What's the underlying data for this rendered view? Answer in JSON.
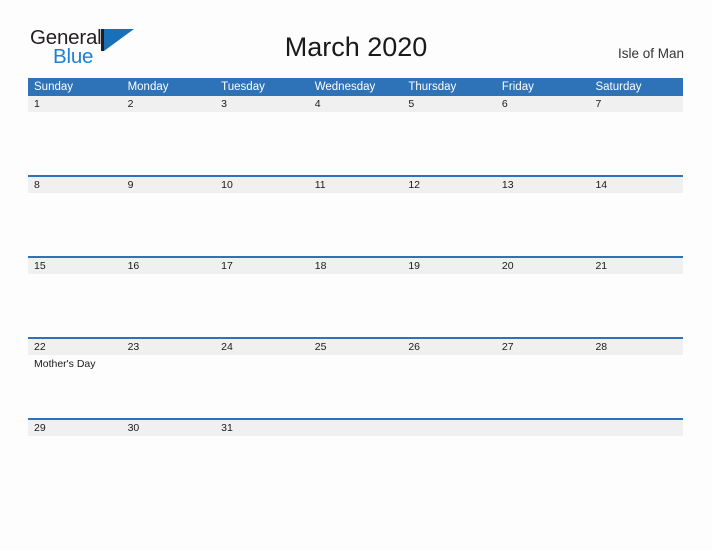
{
  "brand": {
    "name_part1": "General",
    "name_part2": "Blue",
    "mark": "triangle-flag-mark",
    "color_dark": "#231f20",
    "color_blue": "#1e7fd4",
    "color_mark": "#1770b8"
  },
  "header": {
    "title": "March 2020",
    "locale": "Isle of Man"
  },
  "theme": {
    "header_blue": "#2e72b8",
    "date_band_gray": "#f0f0f0",
    "separator_blue": "#2e72b8",
    "page_background": "#fdfdfd",
    "text_dark": "#1a1a1a"
  },
  "calendar": {
    "month": "March",
    "year": "2020",
    "weekdays": [
      "Sunday",
      "Monday",
      "Tuesday",
      "Wednesday",
      "Thursday",
      "Friday",
      "Saturday"
    ],
    "weeks": [
      {
        "days": [
          {
            "date": "1",
            "events": []
          },
          {
            "date": "2",
            "events": []
          },
          {
            "date": "3",
            "events": []
          },
          {
            "date": "4",
            "events": []
          },
          {
            "date": "5",
            "events": []
          },
          {
            "date": "6",
            "events": []
          },
          {
            "date": "7",
            "events": []
          }
        ]
      },
      {
        "days": [
          {
            "date": "8",
            "events": []
          },
          {
            "date": "9",
            "events": []
          },
          {
            "date": "10",
            "events": []
          },
          {
            "date": "11",
            "events": []
          },
          {
            "date": "12",
            "events": []
          },
          {
            "date": "13",
            "events": []
          },
          {
            "date": "14",
            "events": []
          }
        ]
      },
      {
        "days": [
          {
            "date": "15",
            "events": []
          },
          {
            "date": "16",
            "events": []
          },
          {
            "date": "17",
            "events": []
          },
          {
            "date": "18",
            "events": []
          },
          {
            "date": "19",
            "events": []
          },
          {
            "date": "20",
            "events": []
          },
          {
            "date": "21",
            "events": []
          }
        ]
      },
      {
        "days": [
          {
            "date": "22",
            "events": [
              "Mother's Day"
            ]
          },
          {
            "date": "23",
            "events": []
          },
          {
            "date": "24",
            "events": []
          },
          {
            "date": "25",
            "events": []
          },
          {
            "date": "26",
            "events": []
          },
          {
            "date": "27",
            "events": []
          },
          {
            "date": "28",
            "events": []
          }
        ]
      },
      {
        "days": [
          {
            "date": "29",
            "events": []
          },
          {
            "date": "30",
            "events": []
          },
          {
            "date": "31",
            "events": []
          },
          {
            "date": "",
            "events": []
          },
          {
            "date": "",
            "events": []
          },
          {
            "date": "",
            "events": []
          },
          {
            "date": "",
            "events": []
          }
        ]
      }
    ]
  }
}
